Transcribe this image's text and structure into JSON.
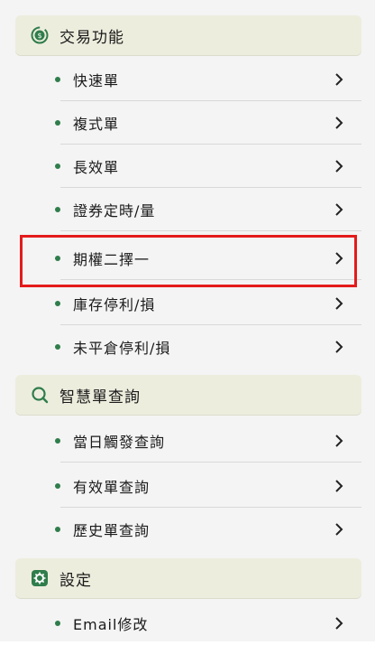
{
  "sections": [
    {
      "title": "交易功能",
      "icon": "dollar-refresh-icon"
    },
    {
      "title": "智慧單查詢",
      "icon": "search-icon"
    },
    {
      "title": "設定",
      "icon": "gear-icon"
    }
  ],
  "trade_items": [
    "快速單",
    "複式單",
    "長效單",
    "證券定時/量",
    "期權二擇一",
    "庫存停利/損",
    "未平倉停利/損"
  ],
  "query_items": [
    "當日觸發查詢",
    "有效單查詢",
    "歷史單查詢"
  ],
  "setting_items": [
    "Email修改"
  ],
  "colors": {
    "accent": "#2f7d4b",
    "header_bg": "#ededde",
    "highlight": "#e41b1b"
  }
}
